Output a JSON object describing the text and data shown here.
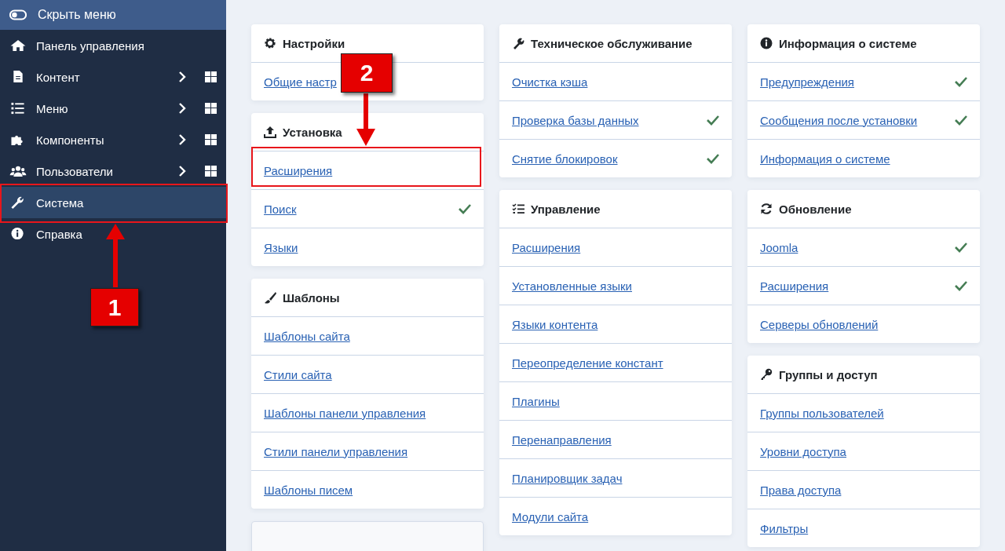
{
  "sidebar": {
    "toggle": {
      "label": "Скрыть меню"
    },
    "items": [
      {
        "label": "Панель управления",
        "expandable": false,
        "selected": false
      },
      {
        "label": "Контент",
        "expandable": true,
        "selected": false
      },
      {
        "label": "Меню",
        "expandable": true,
        "selected": false
      },
      {
        "label": "Компоненты",
        "expandable": true,
        "selected": false
      },
      {
        "label": "Пользователи",
        "expandable": true,
        "selected": false
      },
      {
        "label": "Система",
        "expandable": false,
        "selected": true
      },
      {
        "label": "Справка",
        "expandable": false,
        "selected": false
      }
    ]
  },
  "columns": [
    [
      {
        "kind": "panel",
        "title": "Настройки",
        "links": [
          {
            "label": "Общие настр",
            "checked": false
          }
        ]
      },
      {
        "kind": "panel",
        "title": "Установка",
        "links": [
          {
            "label": "Расширения",
            "checked": false
          },
          {
            "label": "Поиск",
            "checked": true
          },
          {
            "label": "Языки",
            "checked": false
          }
        ]
      },
      {
        "kind": "panel",
        "title": "Шаблоны",
        "links": [
          {
            "label": "Шаблоны сайта",
            "checked": false
          },
          {
            "label": "Стили сайта",
            "checked": false
          },
          {
            "label": "Шаблоны панели управления",
            "checked": false
          },
          {
            "label": "Стили панели управления",
            "checked": false
          },
          {
            "label": "Шаблоны писем",
            "checked": false
          }
        ]
      },
      {
        "kind": "empty"
      }
    ],
    [
      {
        "kind": "panel",
        "title": "Техническое обслуживание",
        "links": [
          {
            "label": "Очистка кэша",
            "checked": false
          },
          {
            "label": "Проверка базы данных",
            "checked": true
          },
          {
            "label": "Снятие блокировок",
            "checked": true
          }
        ]
      },
      {
        "kind": "panel",
        "title": "Управление",
        "links": [
          {
            "label": "Расширения",
            "checked": false
          },
          {
            "label": "Установленные языки",
            "checked": false
          },
          {
            "label": "Языки контента",
            "checked": false
          },
          {
            "label": "Переопределение констант",
            "checked": false
          },
          {
            "label": "Плагины",
            "checked": false
          },
          {
            "label": "Перенаправления",
            "checked": false
          },
          {
            "label": "Планировщик задач",
            "checked": false
          },
          {
            "label": "Модули сайта",
            "checked": false
          }
        ]
      }
    ],
    [
      {
        "kind": "panel",
        "title": "Информация о системе",
        "links": [
          {
            "label": "Предупреждения",
            "checked": true
          },
          {
            "label": "Сообщения после установки",
            "checked": true
          },
          {
            "label": "Информация о системе",
            "checked": false
          }
        ]
      },
      {
        "kind": "panel",
        "title": "Обновление",
        "links": [
          {
            "label": "Joomla",
            "checked": true
          },
          {
            "label": "Расширения",
            "checked": true
          },
          {
            "label": "Серверы обновлений",
            "checked": false
          }
        ]
      },
      {
        "kind": "panel",
        "title": "Группы и доступ",
        "links": [
          {
            "label": "Группы пользователей",
            "checked": false
          },
          {
            "label": "Уровни доступа",
            "checked": false
          },
          {
            "label": "Права доступа",
            "checked": false
          },
          {
            "label": "Фильтры",
            "checked": false
          }
        ]
      }
    ]
  ],
  "annotations": [
    {
      "label": "1"
    },
    {
      "label": "2"
    }
  ]
}
